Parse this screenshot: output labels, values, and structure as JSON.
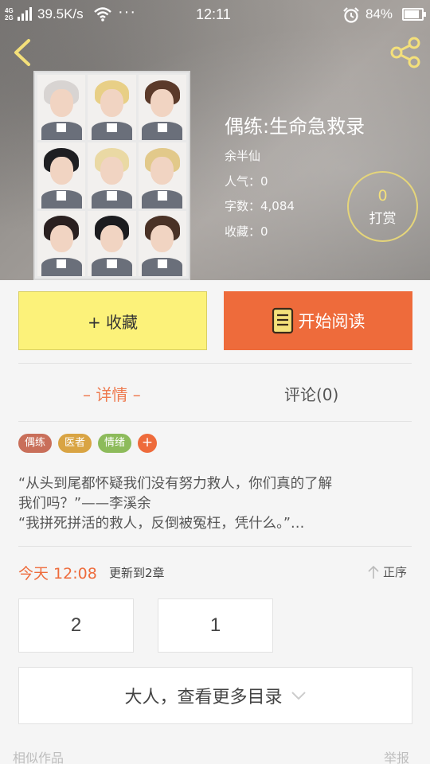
{
  "status_bar": {
    "network_top": "4G",
    "network_bottom": "2G",
    "speed": "39.5K/s",
    "dots": "···",
    "time": "12:11",
    "battery": "84%",
    "battery_level": 0.84
  },
  "book": {
    "title": "偶练:生命急救录",
    "author": "余半仙",
    "popularity": "人气：0",
    "word_count": "字数：4,084",
    "favorites": "收藏：0",
    "tip_count": "0",
    "tip_label": "打赏"
  },
  "actions": {
    "favorite_label": "+ 收藏",
    "read_label": "开始阅读"
  },
  "tabs": {
    "details": "– 详情 –",
    "comments": "评论(0)"
  },
  "tags": [
    {
      "label": "偶练",
      "color": "#c96f5a"
    },
    {
      "label": "医者",
      "color": "#d9a443"
    },
    {
      "label": "情绪",
      "color": "#8dbb5b"
    }
  ],
  "tag_add": "+",
  "description": {
    "line1": "“从头到尾都怀疑我们没有努力救人，你们真的了解",
    "line2": "我们吗？”——李溪余",
    "line3": "“我拼死拼活的救人，反倒被冤枉，凭什么。”…"
  },
  "update": {
    "time": "今天 12:08",
    "text": "更新到2章",
    "sort": "正序"
  },
  "chapters": [
    "2",
    "1"
  ],
  "more_catalog": "大人，查看更多目录",
  "footer": {
    "similar": "相似作品",
    "report": "举报"
  },
  "colors": {
    "accent": "#ee6b3b",
    "favorite_bg": "#fcf27a",
    "tip_ring": "#e5d57a"
  }
}
